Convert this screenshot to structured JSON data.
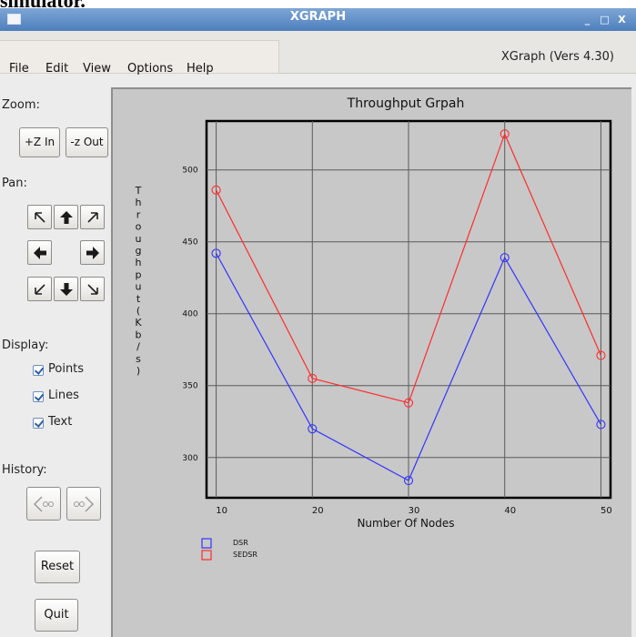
{
  "cut_heading": "simulator.",
  "window": {
    "title": "XGRAPH",
    "buttons": {
      "minimize": "_",
      "maximize": "□",
      "close": "X"
    }
  },
  "menu": {
    "items": [
      "File",
      "Edit",
      "View",
      "Options",
      "Help"
    ],
    "version": "XGraph (Vers 4.30)"
  },
  "sidebar": {
    "zoom_label": "Zoom:",
    "zoom_in": "+Z In",
    "zoom_out": "-z Out",
    "pan_label": "Pan:",
    "display_label": "Display:",
    "display_options": [
      {
        "label": "Points",
        "checked": true
      },
      {
        "label": "Lines",
        "checked": true
      },
      {
        "label": "Text",
        "checked": true
      }
    ],
    "history_label": "History:",
    "reset": "Reset",
    "quit": "Quit"
  },
  "icons": {
    "pan": [
      "arrow-up-left-icon",
      "arrow-up-icon",
      "arrow-up-right-icon",
      "arrow-left-icon",
      "arrow-right-icon",
      "arrow-down-left-icon",
      "arrow-down-icon",
      "arrow-down-right-icon"
    ],
    "history": [
      "history-back-icon",
      "history-forward-icon"
    ]
  },
  "colors": {
    "dsr": "#3333ff",
    "sedsr": "#ff2b2b",
    "plot_bg": "#c8c8c8",
    "titlebar": "#5b89c6"
  },
  "chart_data": {
    "type": "line",
    "title": "Throughput Grpah",
    "xlabel": "Number Of Nodes",
    "ylabel": "Throughput(Kb/s)",
    "x": [
      10,
      20,
      30,
      40,
      50
    ],
    "x_tick_labels": [
      "10",
      "20",
      "30",
      "40",
      "50"
    ],
    "y_ticks": [
      300,
      350,
      400,
      450,
      500
    ],
    "xlim": [
      9,
      51
    ],
    "ylim": [
      272,
      534
    ],
    "grid": true,
    "legend_placement": "bottom-left",
    "series": [
      {
        "name": "DSR",
        "values": [
          442,
          320,
          284,
          439,
          323
        ]
      },
      {
        "name": "SEDSR",
        "values": [
          486,
          355,
          338,
          525,
          371
        ]
      }
    ]
  }
}
